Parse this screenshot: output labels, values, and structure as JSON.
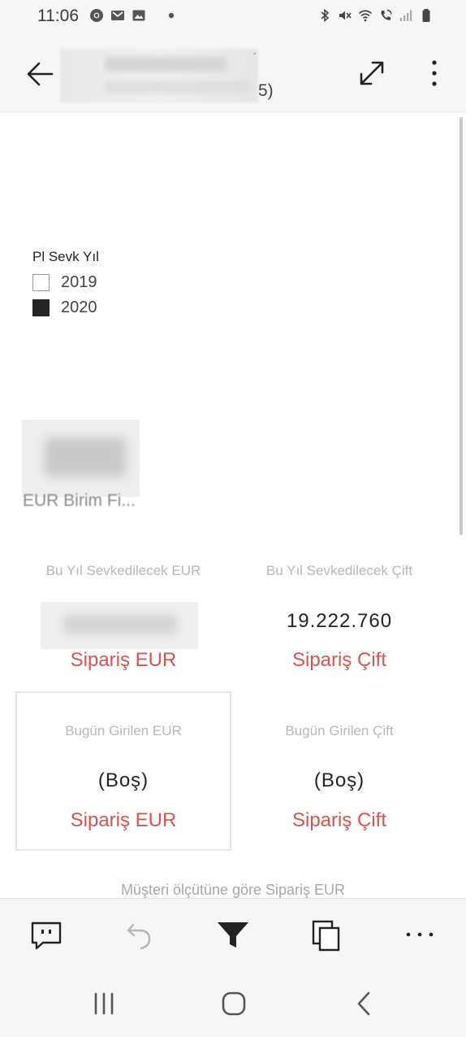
{
  "status_bar": {
    "time": "11:06",
    "left_icons": [
      "chrome-icon",
      "gmail-icon",
      "gallery-icon",
      "dot-icon"
    ],
    "right_icons": [
      "bluetooth-icon",
      "mute-icon",
      "wifi-icon",
      "wifi-calling-icon",
      "signal-icon",
      "battery-icon"
    ]
  },
  "header": {
    "title_suffix": "5)",
    "title_mark": "´",
    "back_icon": "arrow-left-icon",
    "expand_icon": "expand-icon",
    "more_icon": "more-vertical-icon"
  },
  "slicer": {
    "title": "Pl Sevk Yıl",
    "items": [
      {
        "label": "2019",
        "checked": false
      },
      {
        "label": "2020",
        "checked": true
      }
    ]
  },
  "card": {
    "caption": "EUR Birim Fi..."
  },
  "kpis": [
    {
      "label": "Bu Yıl Sevkedilecek  EUR",
      "value": "",
      "sub": "Sipariş EUR"
    },
    {
      "label": "Bu Yıl Sevkedilecek Çift",
      "value": "19.222.760",
      "sub": "Sipariş Çift"
    },
    {
      "label": "Bugün Girilen EUR",
      "value": "(Boş)",
      "sub": "Sipariş EUR"
    },
    {
      "label": "Bugün Girilen Çift",
      "value": "(Boş)",
      "sub": "Sipariş Çift"
    }
  ],
  "bottom_caption": "Müşteri ölçütüne göre Sipariş EUR",
  "toolbar": {
    "items": [
      "comment-icon",
      "undo-icon",
      "filter-icon",
      "pages-icon",
      "more-horizontal-icon"
    ]
  },
  "navbar": {
    "items": [
      "recent-apps-icon",
      "home-icon",
      "back-icon"
    ]
  },
  "colors": {
    "accent_red": "#d9534f",
    "chrome_bg": "#f7f6f4",
    "text_dark": "#252423"
  }
}
